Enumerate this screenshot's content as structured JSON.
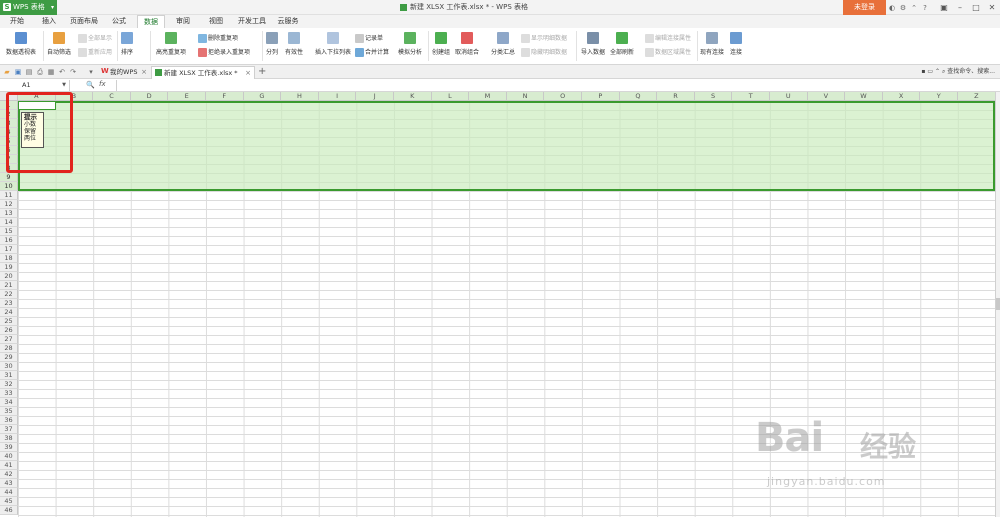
{
  "titlebar": {
    "app_name": "WPS 表格",
    "doc_title": "新建 XLSX 工作表.xlsx * - WPS 表格",
    "login": "未登录"
  },
  "menu": {
    "tabs": [
      "开始",
      "插入",
      "页面布局",
      "公式",
      "数据",
      "审阅",
      "视图",
      "开发工具",
      "云服务"
    ],
    "active": "数据"
  },
  "ribbon": {
    "pivot": "数据透视表",
    "autofilter": "自动筛选",
    "show_all": "全部显示",
    "reapply": "重新应用",
    "sort": "排序",
    "highlight_dup": "高亮重复项",
    "remove_dup": "删除重复项",
    "reject_dup": "拒绝录入重复项",
    "text_to_cols": "分列",
    "validity": "有效性",
    "dropdown": "插入下拉列表",
    "record": "记录单",
    "consolidate": "合并计算",
    "whatif": "模拟分析",
    "group": "创建组",
    "ungroup": "取消组合",
    "subtotal": "分类汇总",
    "show_detail": "显示明细数据",
    "hide_detail": "隐藏明细数据",
    "import": "导入数据",
    "refresh_all": "全部刷新",
    "edit_links": "编辑连接属性",
    "range_props": "数据区域属性",
    "existing_conn": "现有连接",
    "connect": "连接"
  },
  "doc_tabs": {
    "home_tab": "我的WPS",
    "file_tab": "新建 XLSX 工作表.xlsx *",
    "search": "查找命令、搜索..."
  },
  "formula_bar": {
    "cell_ref": "A1",
    "fx": "fx",
    "value": ""
  },
  "grid": {
    "columns": [
      "A",
      "B",
      "C",
      "D",
      "E",
      "F",
      "G",
      "H",
      "I",
      "J",
      "K",
      "L",
      "M",
      "N",
      "O",
      "P",
      "Q",
      "R",
      "S",
      "T",
      "U",
      "V",
      "W",
      "X",
      "Y",
      "Z"
    ],
    "rows": [
      "1",
      "2",
      "3",
      "4",
      "5",
      "6",
      "7",
      "8",
      "9",
      "10",
      "11",
      "12",
      "13",
      "14",
      "15",
      "16",
      "17",
      "18",
      "19",
      "20",
      "21",
      "22",
      "23",
      "24",
      "25",
      "26",
      "27",
      "28",
      "29",
      "30",
      "31",
      "32",
      "33",
      "34",
      "35",
      "36",
      "37",
      "38",
      "39",
      "40",
      "41",
      "42",
      "43",
      "44",
      "45",
      "46"
    ]
  },
  "comment": {
    "title": "提示",
    "line1": "小数",
    "line2": "保留",
    "line3": "两位"
  },
  "watermark": {
    "main": "Bai",
    "jy": "经验",
    "sub": "jingyan.baidu.com"
  },
  "colors": {
    "brand_green": "#3e9c44",
    "selection": "#c7ebba",
    "highlight_red": "#e1241d",
    "login_orange": "#e8703a"
  }
}
